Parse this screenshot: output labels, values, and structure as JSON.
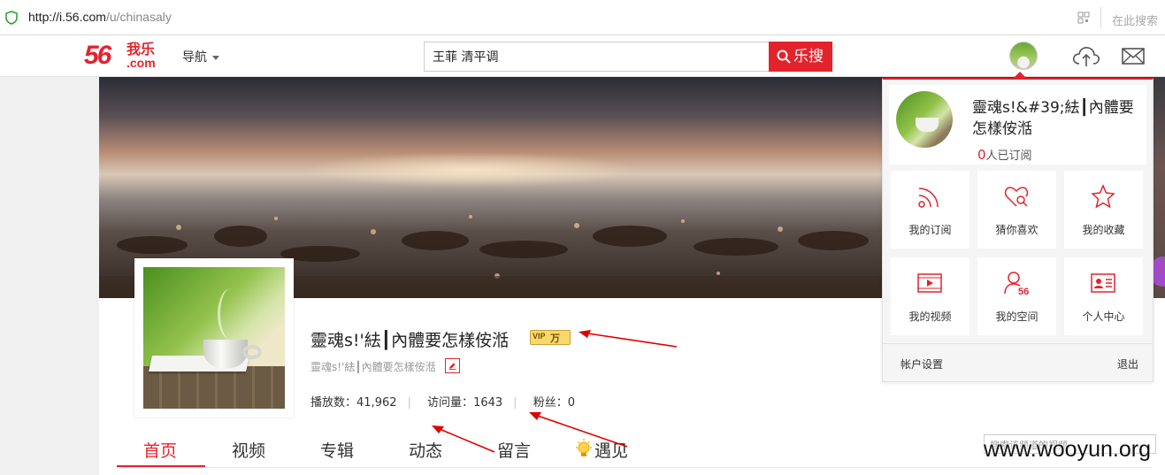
{
  "browser": {
    "url_host": "http://i.56.com",
    "url_path": "/u/chinasaly",
    "site_search": "在此搜索"
  },
  "header": {
    "logo_number": "56",
    "logo_text": "我乐",
    "logo_com": ".com",
    "nav_label": "导航",
    "search_value": "王菲 清平调",
    "search_button": "乐搜"
  },
  "profile": {
    "name": "靈魂s!'紶┃內體要怎樣侒湉",
    "badge_text": "万",
    "badge_small": "VIP",
    "subtitle": "靈魂s!'紶┃內體要怎樣侒湉",
    "stats": [
      {
        "label": "播放数：",
        "value": "41,962"
      },
      {
        "label": "访问量：",
        "value": "1643"
      },
      {
        "label": "粉丝：",
        "value": "0"
      }
    ]
  },
  "tabs": [
    "首页",
    "视频",
    "专辑",
    "动态",
    "留言",
    "遇见"
  ],
  "channel_search_placeholder": "搜索该频道的视频",
  "dropdown": {
    "user_name": "靈魂s!&#39;紶┃內體要怎樣侒湉",
    "subscribers_count": "0",
    "subscribers_label": "人已订阅",
    "items": [
      {
        "label": "我的订阅",
        "icon": "rss-icon"
      },
      {
        "label": "猜你喜欢",
        "icon": "heart-search-icon"
      },
      {
        "label": "我的收藏",
        "icon": "star-icon"
      },
      {
        "label": "我的视频",
        "icon": "video-icon"
      },
      {
        "label": "我的空间",
        "icon": "user-56-icon"
      },
      {
        "label": "个人中心",
        "icon": "id-card-icon"
      }
    ],
    "account_settings": "帐户设置",
    "logout": "退出"
  },
  "watermark": "www.wooyun.org",
  "colors": {
    "accent": "#e3232c",
    "annotation": "#e00000"
  }
}
